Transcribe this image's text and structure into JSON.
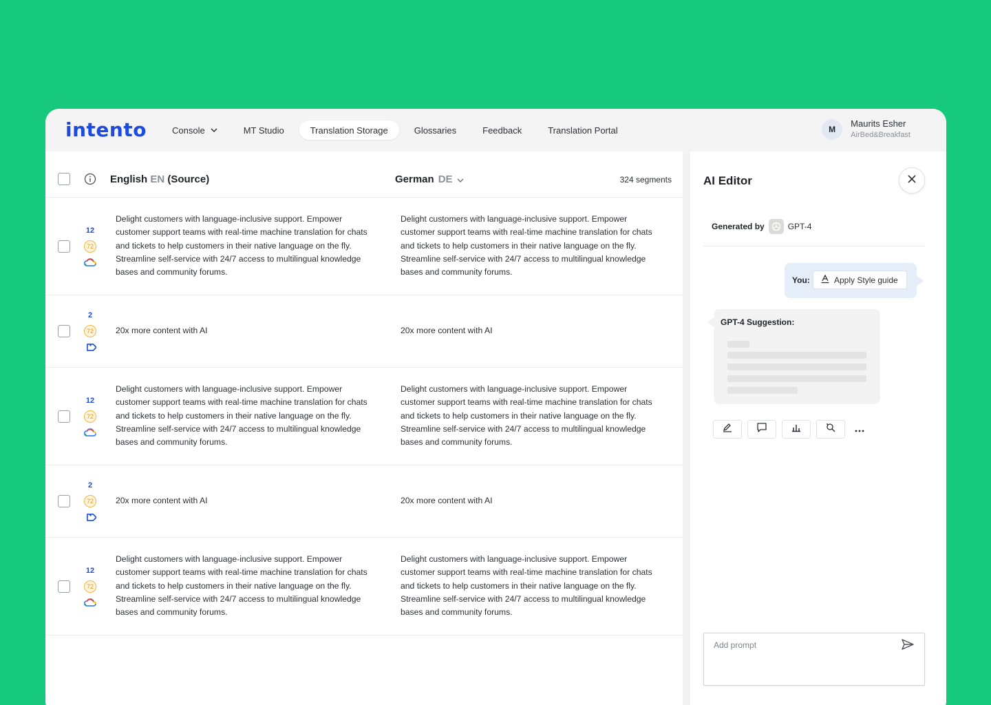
{
  "brand": {
    "logo_text": "intento"
  },
  "nav": {
    "items": [
      {
        "label": "Console",
        "has_dropdown": true,
        "active": false
      },
      {
        "label": "MT Studio",
        "active": false
      },
      {
        "label": "Translation Storage",
        "active": true
      },
      {
        "label": "Glossaries",
        "active": false
      },
      {
        "label": "Feedback",
        "active": false
      },
      {
        "label": "Translation Portal",
        "active": false
      }
    ]
  },
  "user": {
    "initial": "M",
    "name": "Maurits Esher",
    "org": "AirBed&Breakfast"
  },
  "table": {
    "source_lang": "English",
    "source_code": "EN",
    "source_suffix": "(Source)",
    "target_lang": "German",
    "target_code": "DE",
    "segment_count": "324 segments",
    "rows": [
      {
        "count": "12",
        "score": "72",
        "icon": "cloud-icon",
        "source": "Delight customers with language-inclusive support. Empower customer support teams with real-time machine translation for chats and tickets to help customers in their native language on the fly. Streamline self-service with 24/7 access to multilingual knowledge bases and community forums.",
        "target": "Delight customers with language-inclusive support. Empower customer support teams with real-time machine translation for chats and tickets to help customers in their native language on the fly. Streamline self-service with 24/7 access to multilingual knowledge bases and community forums."
      },
      {
        "count": "2",
        "score": "72",
        "icon": "tag-icon",
        "source": "20x more content with AI",
        "target": "20x more content with AI"
      },
      {
        "count": "12",
        "score": "72",
        "icon": "cloud-icon",
        "source": "Delight customers with language-inclusive support. Empower customer support teams with real-time machine translation for chats and tickets to help customers in their native language on the fly. Streamline self-service with 24/7 access to multilingual knowledge bases and community forums.",
        "target": "Delight customers with language-inclusive support. Empower customer support teams with real-time machine translation for chats and tickets to help customers in their native language on the fly. Streamline self-service with 24/7 access to multilingual knowledge bases and community forums."
      },
      {
        "count": "2",
        "score": "72",
        "icon": "tag-icon",
        "source": "20x more content with AI",
        "target": "20x more content with AI"
      },
      {
        "count": "12",
        "score": "72",
        "icon": "cloud-icon",
        "source": "Delight customers with language-inclusive support. Empower customer support teams with real-time machine translation for chats and tickets to help customers in their native language on the fly. Streamline self-service with 24/7 access to multilingual knowledge bases and community forums.",
        "target": "Delight customers with language-inclusive support. Empower customer support teams with real-time machine translation for chats and tickets to help customers in their native language on the fly. Streamline self-service with 24/7 access to multilingual knowledge bases and community forums."
      }
    ]
  },
  "ai_editor": {
    "title": "AI Editor",
    "generated_by_label": "Generated by",
    "model": "GPT-4",
    "you_label": "You:",
    "action_label": "Apply Style guide",
    "suggestion_title": "GPT-4 Suggestion:",
    "tools": [
      "edit-icon",
      "comment-icon",
      "chart-icon",
      "search-refresh-icon",
      "more-icon"
    ],
    "prompt_placeholder": "Add prompt"
  },
  "colors": {
    "background": "#17c97c",
    "brand_blue": "#1b4be0",
    "score_orange": "#f5b43a"
  }
}
